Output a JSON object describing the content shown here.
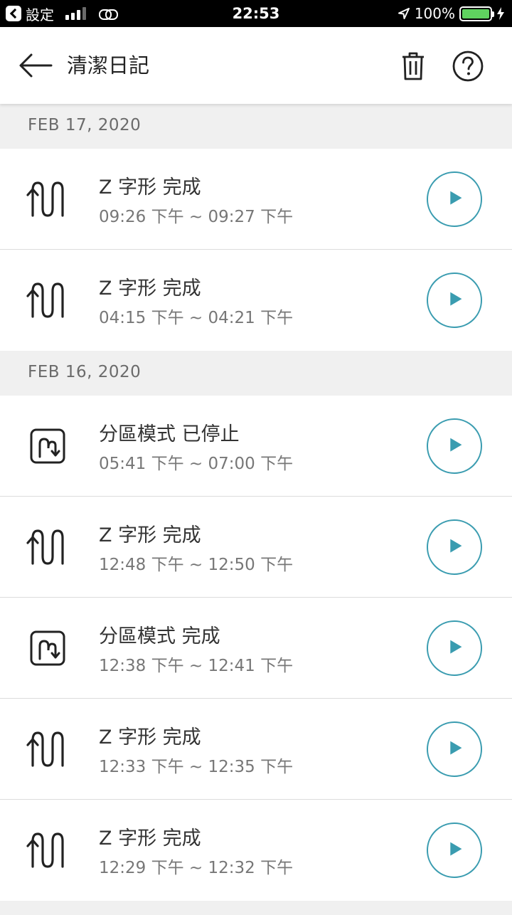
{
  "status_bar": {
    "carrier": "設定",
    "time": "22:53",
    "battery": "100%",
    "battery_level": 1.0
  },
  "header": {
    "title": "清潔日記"
  },
  "colors": {
    "accent": "#3a9cb0",
    "text_primary": "#333333",
    "text_secondary": "#777777",
    "section_bg": "#f0f0f0",
    "battery": "#5fd35f"
  },
  "groups": [
    {
      "date": "FEB 17, 2020",
      "entries": [
        {
          "icon": "zigzag-icon",
          "title": "Z 字形 完成",
          "time": "09:26 下午 ~ 09:27 下午"
        },
        {
          "icon": "zigzag-icon",
          "title": "Z 字形 完成",
          "time": "04:15 下午 ~ 04:21 下午"
        }
      ]
    },
    {
      "date": "FEB 16, 2020",
      "entries": [
        {
          "icon": "zone-mode-icon",
          "title": "分區模式 已停止",
          "time": "05:41 下午 ~ 07:00 下午"
        },
        {
          "icon": "zigzag-icon",
          "title": "Z 字形 完成",
          "time": "12:48 下午 ~ 12:50 下午"
        },
        {
          "icon": "zone-mode-icon",
          "title": "分區模式 完成",
          "time": "12:38 下午 ~ 12:41 下午"
        },
        {
          "icon": "zigzag-icon",
          "title": "Z 字形 完成",
          "time": "12:33 下午 ~ 12:35 下午"
        },
        {
          "icon": "zigzag-icon",
          "title": "Z 字形 完成",
          "time": "12:29 下午 ~ 12:32 下午"
        }
      ]
    }
  ]
}
